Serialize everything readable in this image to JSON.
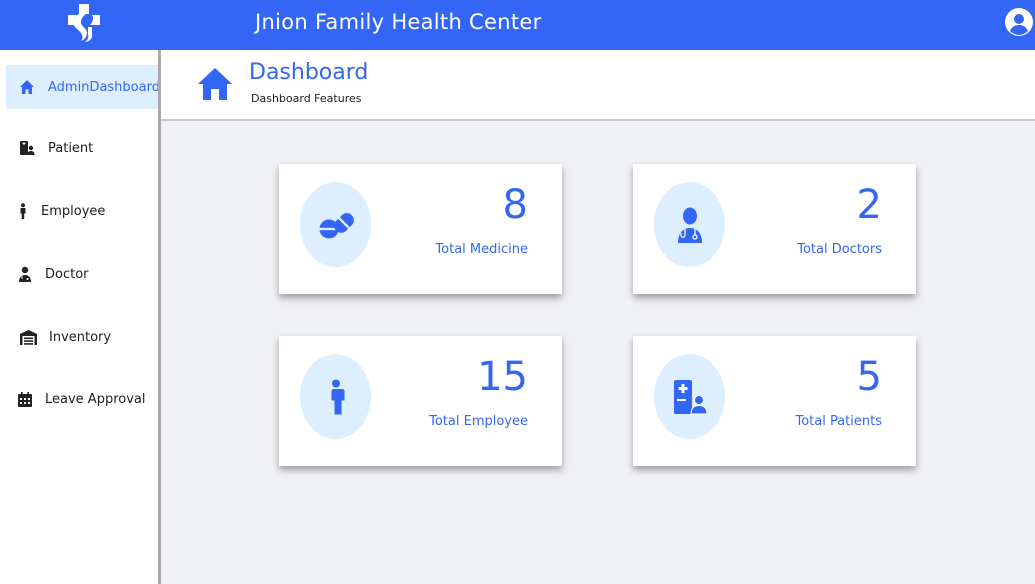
{
  "header": {
    "title": "Jnion Family Health Center"
  },
  "sidebar": {
    "items": [
      {
        "label": "AdminDashboard",
        "icon": "home-icon",
        "active": true
      },
      {
        "label": "Patient",
        "icon": "patient-icon"
      },
      {
        "label": "Employee",
        "icon": "person-icon"
      },
      {
        "label": "Doctor",
        "icon": "doctor-icon"
      },
      {
        "label": "Inventory",
        "icon": "warehouse-icon"
      },
      {
        "label": "Leave Approval",
        "icon": "calendar-icon"
      }
    ]
  },
  "page": {
    "title": "Dashboard",
    "subtitle": "Dashboard Features"
  },
  "cards": [
    {
      "value": "8",
      "label": "Total Medicine",
      "icon": "pills-icon"
    },
    {
      "value": "2",
      "label": "Total Doctors",
      "icon": "doctor-icon"
    },
    {
      "value": "15",
      "label": "Total Employee",
      "icon": "person-icon"
    },
    {
      "value": "5",
      "label": "Total Patients",
      "icon": "patient-icon"
    }
  ],
  "colors": {
    "accent": "#3366f5",
    "active_bg": "#ddeeff",
    "page_bg": "#f0f1f5"
  }
}
